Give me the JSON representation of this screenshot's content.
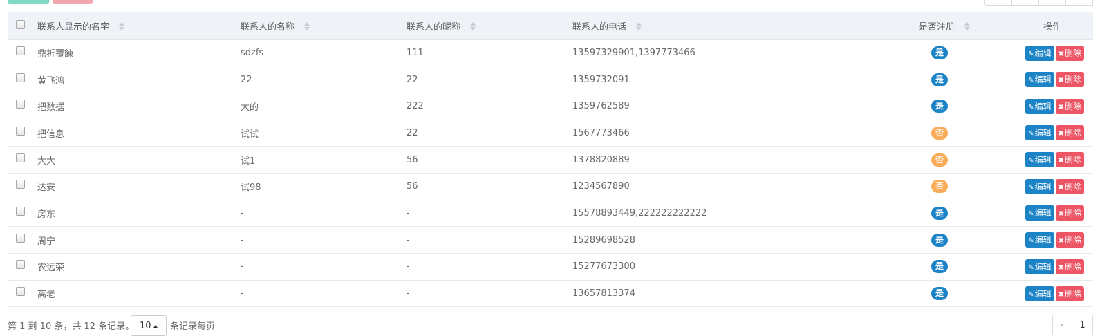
{
  "table": {
    "headers": {
      "display_name": "联系人显示的名字",
      "name": "联系人的名称",
      "nickname": "联系人的昵称",
      "phone": "联系人的电话",
      "registered": "是否注册",
      "actions": "操作"
    },
    "rows": [
      {
        "display_name": "鼎折覆餗",
        "name": "sdzfs",
        "nickname": "111",
        "phone": "13597329901,1397773466",
        "registered": "是",
        "registered_yes": true
      },
      {
        "display_name": "黄飞鸿",
        "name": "22",
        "nickname": "22",
        "phone": "1359732091",
        "registered": "是",
        "registered_yes": true
      },
      {
        "display_name": "把数据",
        "name": "大的",
        "nickname": "222",
        "phone": "1359762589",
        "registered": "是",
        "registered_yes": true
      },
      {
        "display_name": "把信息",
        "name": "试试",
        "nickname": "22",
        "phone": "1567773466",
        "registered": "否",
        "registered_yes": false
      },
      {
        "display_name": "大大",
        "name": "试1",
        "nickname": "56",
        "phone": "1378820889",
        "registered": "否",
        "registered_yes": false
      },
      {
        "display_name": "达安",
        "name": "试98",
        "nickname": "56",
        "phone": "1234567890",
        "registered": "否",
        "registered_yes": false
      },
      {
        "display_name": "房东",
        "name": "-",
        "nickname": "-",
        "phone": "15578893449,222222222222",
        "registered": "是",
        "registered_yes": true
      },
      {
        "display_name": "周宁",
        "name": "-",
        "nickname": "-",
        "phone": "15289698528",
        "registered": "是",
        "registered_yes": true
      },
      {
        "display_name": "农远荣",
        "name": "-",
        "nickname": "-",
        "phone": "15277673300",
        "registered": "是",
        "registered_yes": true
      },
      {
        "display_name": "高老",
        "name": "-",
        "nickname": "-",
        "phone": "13657813374",
        "registered": "是",
        "registered_yes": true
      }
    ],
    "edit_label": "编辑",
    "delete_label": "删除"
  },
  "footer": {
    "summary": "第 1 到 10 条，共 12 条记录。",
    "page_size": "10",
    "per_page_label": "条记录每页",
    "prev": "‹",
    "current_page": "1"
  },
  "colors": {
    "yes_badge": "#1c84c6",
    "no_badge": "#f8ac59",
    "edit_button": "#1c84c6",
    "delete_button": "#ed5565",
    "header_bg": "#eff3f8"
  }
}
